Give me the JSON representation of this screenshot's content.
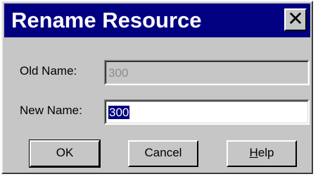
{
  "dialog": {
    "title": "Rename Resource",
    "close_symbol": "✕",
    "close_icon": "close-icon"
  },
  "old_name": {
    "label": "Old Name:",
    "value": "300",
    "disabled": true
  },
  "new_name": {
    "label": "New Name:",
    "value": "300",
    "selected": true
  },
  "buttons": {
    "ok": "OK",
    "cancel": "Cancel",
    "help_mnemonic": "H",
    "help_rest": "elp"
  },
  "colors": {
    "titlebar": "#000080",
    "face": "#c6c6c6",
    "selection": "#000080"
  }
}
